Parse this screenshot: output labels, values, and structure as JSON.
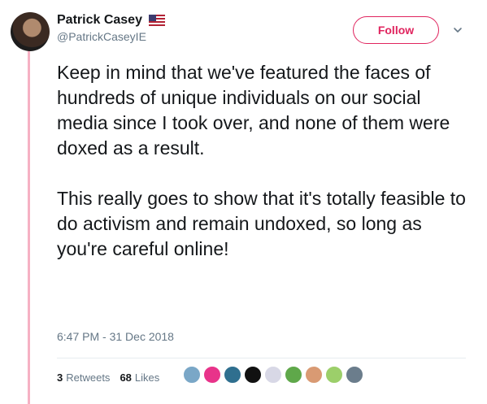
{
  "author": {
    "display_name": "Patrick Casey",
    "handle": "@PatrickCaseyIE",
    "flag_icon": "us-flag-icon"
  },
  "actions": {
    "follow_label": "Follow"
  },
  "tweet": {
    "text": "Keep in mind that we've featured the faces of hundreds of unique individuals on our social media since I took over, and none of them were doxed as a result.\n\nThis really goes to show that it's totally feasible to do activism and remain undoxed, so long as you're careful online!",
    "timestamp": "6:47 PM - 31 Dec 2018"
  },
  "stats": {
    "retweets_count": "3",
    "retweets_label": "Retweets",
    "likes_count": "68",
    "likes_label": "Likes"
  },
  "colors": {
    "accent": "#e0245e",
    "thread_line": "#f6b1c3",
    "muted_text": "#657786"
  },
  "liker_avatars": [
    "#7aa7c7",
    "#e8338a",
    "#2f6f8f",
    "#111111",
    "#d8d8e6",
    "#5fa84a",
    "#d99a73",
    "#9ccf6a",
    "#6b7d8c"
  ]
}
